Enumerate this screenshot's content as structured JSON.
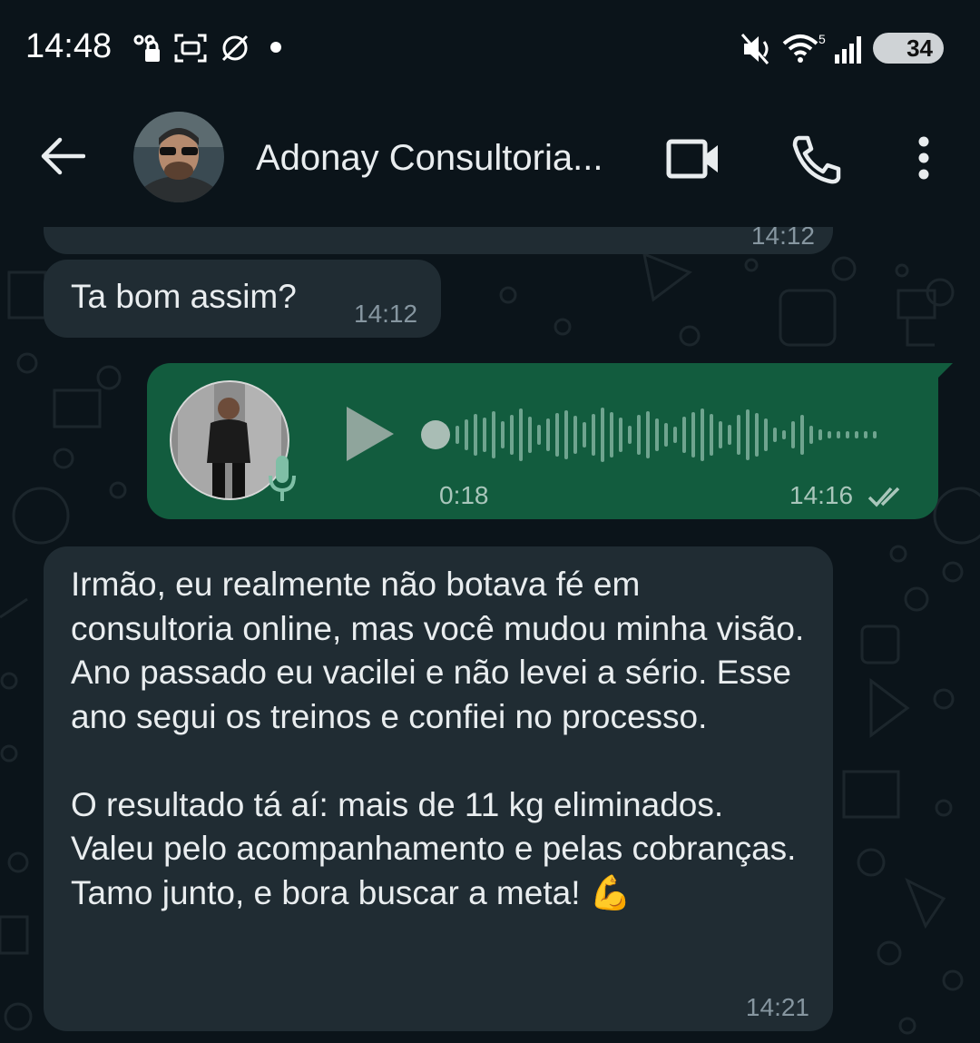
{
  "status_bar": {
    "time": "14:48",
    "battery": "34"
  },
  "header": {
    "contact_name": "Adonay Consultoria..."
  },
  "messages": [
    {
      "type": "text",
      "direction": "incoming",
      "text": "",
      "time": "14:12"
    },
    {
      "type": "text",
      "direction": "incoming",
      "text": "Ta bom assim?",
      "time": "14:12"
    },
    {
      "type": "voice",
      "direction": "outgoing",
      "duration": "0:18",
      "time": "14:16",
      "status": "read"
    },
    {
      "type": "text",
      "direction": "incoming",
      "text": "Irmão, eu realmente não botava fé em consultoria online, mas você mudou minha visão. Ano passado eu vacilei e não levei a sério. Esse ano segui os treinos e confiei no processo.\n\nO resultado tá aí: mais de 11 kg eliminados. Valeu pelo acompanhamento e pelas cobranças. Tamo junto, e bora buscar a meta! 💪",
      "time": "14:21"
    }
  ],
  "colors": {
    "background": "#0b141a",
    "incoming_bubble": "#202c33",
    "outgoing_bubble": "#125c3e"
  }
}
